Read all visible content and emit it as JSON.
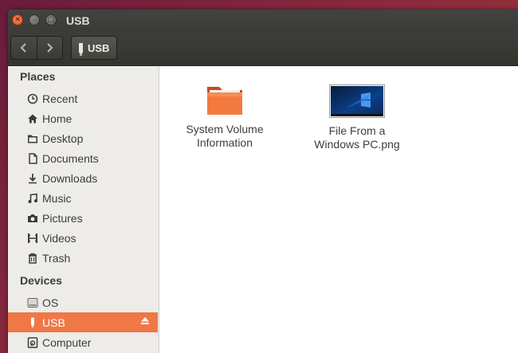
{
  "window": {
    "title": "USB"
  },
  "toolbar": {
    "back_label": "‹",
    "forward_label": "›",
    "path_label": "USB"
  },
  "sidebar": {
    "places_heading": "Places",
    "places": [
      {
        "label": "Recent",
        "icon": "clock-icon"
      },
      {
        "label": "Home",
        "icon": "home-icon"
      },
      {
        "label": "Desktop",
        "icon": "folder-icon"
      },
      {
        "label": "Documents",
        "icon": "document-icon"
      },
      {
        "label": "Downloads",
        "icon": "download-icon"
      },
      {
        "label": "Music",
        "icon": "music-icon"
      },
      {
        "label": "Pictures",
        "icon": "camera-icon"
      },
      {
        "label": "Videos",
        "icon": "film-icon"
      },
      {
        "label": "Trash",
        "icon": "trash-icon"
      }
    ],
    "devices_heading": "Devices",
    "devices": [
      {
        "label": "OS",
        "icon": "drive-icon"
      },
      {
        "label": "USB",
        "icon": "usb-icon",
        "selected": true
      },
      {
        "label": "Computer",
        "icon": "computer-icon"
      }
    ]
  },
  "files": [
    {
      "label": "System Volume Information",
      "icon": "folder-icon"
    },
    {
      "label": "File From a Windows PC.png",
      "icon": "image-thumbnail-icon"
    }
  ],
  "colors": {
    "selection": "#f07746",
    "folder": "#f07746",
    "titlebar": "#3b3b38",
    "sidebar": "#edece9"
  }
}
